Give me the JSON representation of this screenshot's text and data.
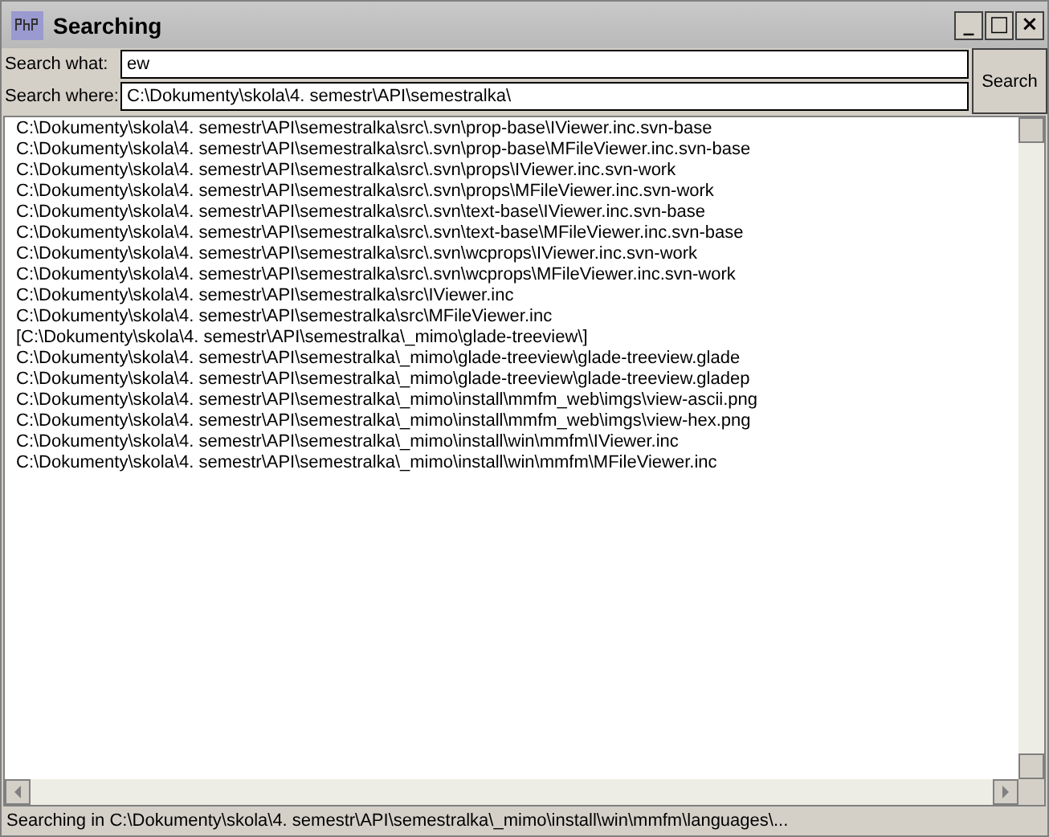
{
  "window": {
    "title": "Searching",
    "controls": [
      "_",
      "□",
      "×"
    ]
  },
  "form": {
    "fields": [
      {
        "label": "Search what:",
        "value": "ew"
      },
      {
        "label": "Search where:",
        "value": "C:\\Dokumenty\\skola\\4. semestr\\API\\semestralka\\"
      }
    ],
    "button": "Search"
  },
  "results": [
    "C:\\Dokumenty\\skola\\4. semestr\\API\\semestralka\\src\\.svn\\prop-base\\IViewer.inc.svn-base",
    "C:\\Dokumenty\\skola\\4. semestr\\API\\semestralka\\src\\.svn\\prop-base\\MFileViewer.inc.svn-base",
    "C:\\Dokumenty\\skola\\4. semestr\\API\\semestralka\\src\\.svn\\props\\IViewer.inc.svn-work",
    "C:\\Dokumenty\\skola\\4. semestr\\API\\semestralka\\src\\.svn\\props\\MFileViewer.inc.svn-work",
    "C:\\Dokumenty\\skola\\4. semestr\\API\\semestralka\\src\\.svn\\text-base\\IViewer.inc.svn-base",
    "C:\\Dokumenty\\skola\\4. semestr\\API\\semestralka\\src\\.svn\\text-base\\MFileViewer.inc.svn-base",
    "C:\\Dokumenty\\skola\\4. semestr\\API\\semestralka\\src\\.svn\\wcprops\\IViewer.inc.svn-work",
    "C:\\Dokumenty\\skola\\4. semestr\\API\\semestralka\\src\\.svn\\wcprops\\MFileViewer.inc.svn-work",
    "C:\\Dokumenty\\skola\\4. semestr\\API\\semestralka\\src\\IViewer.inc",
    "C:\\Dokumenty\\skola\\4. semestr\\API\\semestralka\\src\\MFileViewer.inc",
    "[C:\\Dokumenty\\skola\\4. semestr\\API\\semestralka\\_mimo\\glade-treeview\\]",
    "C:\\Dokumenty\\skola\\4. semestr\\API\\semestralka\\_mimo\\glade-treeview\\glade-treeview.glade",
    "C:\\Dokumenty\\skola\\4. semestr\\API\\semestralka\\_mimo\\glade-treeview\\glade-treeview.gladep",
    "C:\\Dokumenty\\skola\\4. semestr\\API\\semestralka\\_mimo\\install\\mmfm_web\\imgs\\view-ascii.png",
    "C:\\Dokumenty\\skola\\4. semestr\\API\\semestralka\\_mimo\\install\\mmfm_web\\imgs\\view-hex.png",
    "C:\\Dokumenty\\skola\\4. semestr\\API\\semestralka\\_mimo\\install\\win\\mmfm\\IViewer.inc",
    "C:\\Dokumenty\\skola\\4. semestr\\API\\semestralka\\_mimo\\install\\win\\mmfm\\MFileViewer.inc"
  ],
  "status_bar": "Searching in C:\\Dokumenty\\skola\\4. semestr\\API\\semestralka\\_mimo\\install\\win\\mmfm\\languages\\..."
}
